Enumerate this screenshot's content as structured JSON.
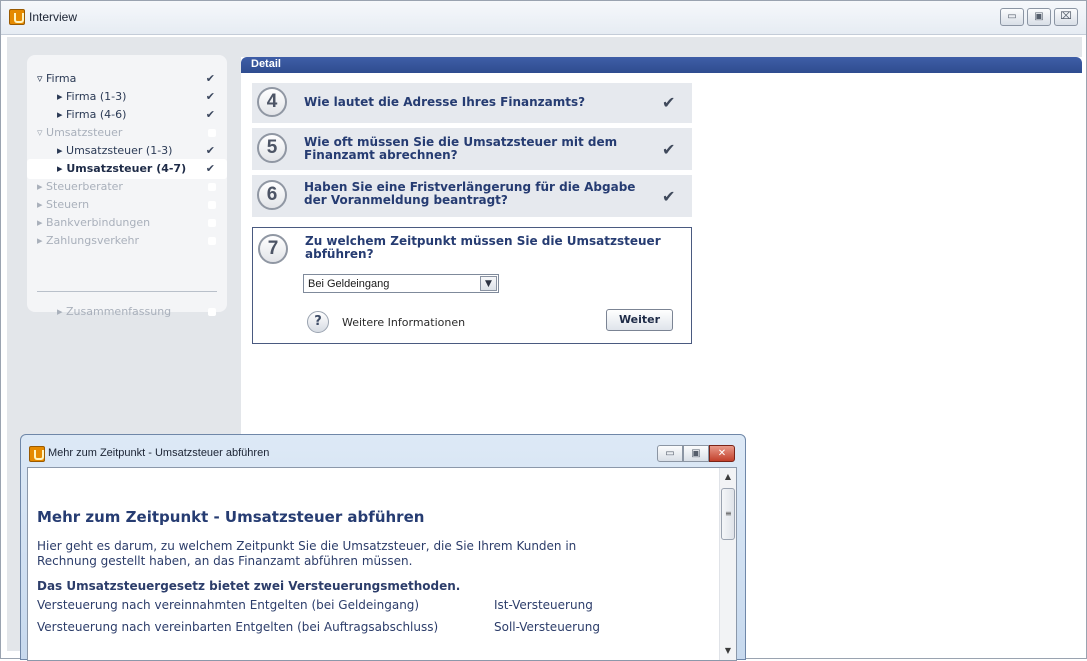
{
  "window": {
    "title": "Interview",
    "minimize_symbol": "▭",
    "maximize_symbol": "▣",
    "close_symbol": "⌧"
  },
  "nav": {
    "items": [
      {
        "label": "▿ Firma",
        "marker": "✔"
      },
      {
        "label": "▸ Firma (1-3)",
        "marker": "✔"
      },
      {
        "label": "▸ Firma (4-6)",
        "marker": "✔"
      },
      {
        "label": "▿ Umsatzsteuer",
        "marker": ""
      },
      {
        "label": "▸ Umsatzsteuer (1-3)",
        "marker": "✔"
      },
      {
        "label": "▸ Umsatzsteuer (4-7)",
        "marker": "✔"
      },
      {
        "label": "▸ Steuerberater",
        "marker": ""
      },
      {
        "label": "▸ Steuern",
        "marker": ""
      },
      {
        "label": "▸ Bankverbindungen",
        "marker": ""
      },
      {
        "label": "▸ Zahlungsverkehr",
        "marker": ""
      },
      {
        "label": "▸ Zusammenfassung",
        "marker": ""
      }
    ]
  },
  "detail": {
    "title": "Detail",
    "questions": [
      {
        "number": "4",
        "text": "Wie lautet die Adresse Ihres Finanzamts?",
        "check": "✔"
      },
      {
        "number": "5",
        "text": "Wie oft müssen Sie die Umsatzsteuer mit dem Finanzamt abrechnen?",
        "check": "✔"
      },
      {
        "number": "6",
        "text": "Haben Sie eine Fristverlängerung für die Abgabe der Voranmeldung beantragt?",
        "check": "✔"
      },
      {
        "number": "7",
        "text": "Zu welchem Zeitpunkt müssen Sie die Umsatzsteuer abführen?",
        "check": ""
      }
    ],
    "select_value": "Bei Geldeingang",
    "select_arrow": "▼",
    "help_symbol": "?",
    "help_label": "Weitere Informationen",
    "weiter_label": "Weiter"
  },
  "popup": {
    "title": "Mehr zum Zeitpunkt - Umsatzsteuer abführen",
    "heading": "Mehr zum Zeitpunkt - Umsatzsteuer abführen",
    "paragraph_line1": "Hier geht es darum, zu welchem Zeitpunkt Sie die Umsatzsteuer, die Sie Ihrem Kunden in",
    "paragraph_line2": "Rechnung gestellt haben, an das Finanzamt abführen müssen.",
    "subheading": "Das Umsatzsteuergesetz bietet zwei Versteuerungsmethoden.",
    "rows": [
      {
        "method": "Versteuerung nach vereinnahmten Entgelten (bei Geldeingang)",
        "name": "Ist-Versteuerung"
      },
      {
        "method": "Versteuerung nach vereinbarten Entgelten (bei Auftragsabschluss)",
        "name": "Soll-Versteuerung"
      }
    ],
    "scroll_up": "▲",
    "scroll_down": "▼",
    "scroll_grip": "≡",
    "close_symbol": "✕"
  }
}
